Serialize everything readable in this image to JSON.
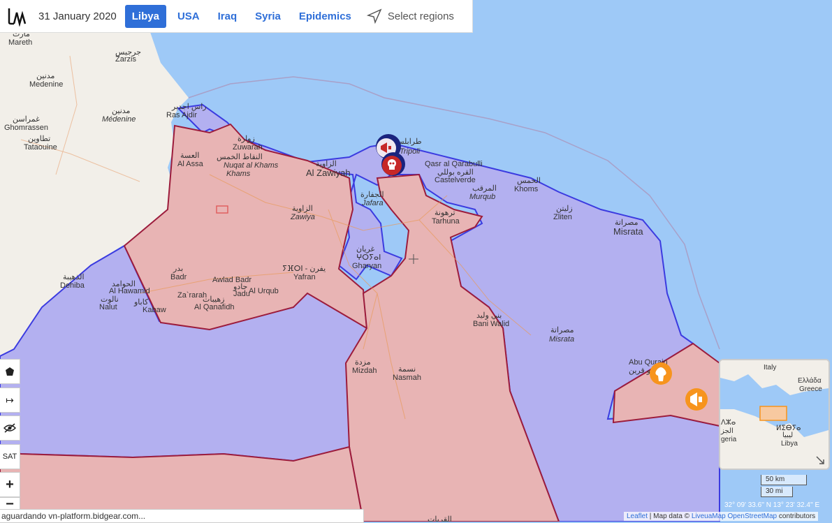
{
  "header": {
    "date": "31 January 2020",
    "tabs": [
      "Libya",
      "USA",
      "Iraq",
      "Syria",
      "Epidemics"
    ],
    "active_tab": "Libya",
    "select_regions_label": "Select regions"
  },
  "controls": {
    "polygon_icon": "polygon-icon",
    "measure_icon": "measure-icon",
    "hide_icon": "eye-slash-icon",
    "sat_label": "SAT",
    "zoom_in": "+",
    "zoom_out": "−"
  },
  "map_labels": {
    "mareth_ar": "مارث",
    "mareth": "Mareth",
    "zarzis_ar": "جرجيس",
    "zarzis": "Zarzis",
    "medenine_ar": "مدنين",
    "medenine": "Medenine",
    "medenine2_ar": "مدنين",
    "medenine2": "Médenine",
    "ghomrassen_ar": "غمراسن",
    "ghomrassen": "Ghomrassen",
    "tataouine_ar": "تطاوين",
    "tataouine": "Tataouine",
    "ras_ajdir_ar": "راس اجدير",
    "ras_ajdir": "Ras Ajdir",
    "zuwarah_ar": "زوارة",
    "zuwarah": "Zuwarah",
    "nuqat_ar": "النقاط الخمس",
    "nuqat": "Nuqat al Khams",
    "al_assa_ar": "العسة",
    "al_assa": "Al Assa",
    "al_zawiyah_ar": "الزاوية",
    "al_zawiyah": "Al Zawiyah",
    "zawiya_ar": "الزاوية",
    "zawiya": "Zawiya",
    "tripoli": "Tripoli",
    "tripoli_ar": "طرابلس",
    "jafara_ar": "الجفارة",
    "jafara": "Jafara",
    "qasr_ar": "Qasr al Qarabulli",
    "qasr_ar2": "القره بوللي",
    "castelverde": "Castelverde",
    "khoms_ar": "الخمس",
    "khoms": "Khoms",
    "murqub_ar": "المرقب",
    "murqub": "Murqub",
    "tarhuna_ar": "ترهونة",
    "tarhuna": "Tarhuna",
    "zliten_ar": "زليتن",
    "zliten": "Zliten",
    "misrata_ar": "مصراتة",
    "misrata": "Misrata",
    "gharyan_ar": "غريان",
    "gharyan_ber": "ⵖⵔⵢⴰⵏ",
    "gharyan": "Gharyan",
    "yafran_ber": "ⵢⴼⵔⵏ - يفرن",
    "yafran": "Yafran",
    "badr_ar": "بدر",
    "badr": "Badr",
    "awlad_badr": "Awlad Badr",
    "jadu_ar": "جادو",
    "jadu": "Jadu",
    "zarah": "Za`rarah",
    "al_urqub": "Al Urqub",
    "al_qanafidh_ar": "زهيبات",
    "al_qanafidh": "Al Qanafidh",
    "dehiba_ar": "الذهيبة",
    "dehiba": "Dehiba",
    "al_hawamid_ar": "الحوامد",
    "al_hawamid": "Al Hawamid",
    "nalut_ar": "نالوت",
    "nalut": "Nalut",
    "kabaw_ar": "كاباو",
    "kabaw": "Kabaw",
    "bani_walid_ar": "بني وليد",
    "bani_walid": "Bani Walid",
    "misrata_region_ar": "مصراتة",
    "misrata_region": "Misrata",
    "mizdah_ar": "مزدة",
    "mizdah": "Mizdah",
    "nasmah_ar": "نسمة",
    "nasmah": "Nasmah",
    "abu_qurain": "Abu Qurain",
    "abu_qurain_ar": "ابو قرين",
    "al_qaryat_ar": "القريات"
  },
  "minimap": {
    "italy": "Italy",
    "greece_gr": "Ελλάδα",
    "greece": "Greece",
    "libya_ber": "ⵍⵉⴱⵢⴰ",
    "libya_ar": "ليبيا",
    "libya": "Libya",
    "algeria_ber": "ⴷⵣⴰ",
    "algeria_ar": "الجز",
    "algeria": "geria"
  },
  "scale": {
    "km": "50 km",
    "mi": "30 mi"
  },
  "coordinates": "32° 09' 33.6'' N 13° 23' 32.4'' E",
  "attribution": {
    "leaflet": "Leaflet",
    "sep": " | Map data © ",
    "liveua": "LiveuaMap",
    "osm": "OpenStreetMap",
    "suffix": " contributors"
  },
  "status_bar": "aguardando vn-platform.bidgear.com...",
  "colors": {
    "sea": "#9ec9f7",
    "land": "#f2efe9",
    "gna_fill": "#b3b0f0",
    "gna_border": "#3b3be0",
    "lna_fill": "#e8b4b4",
    "lna_border": "#9c1c3c",
    "marker_orange": "#f7941d",
    "marker_red": "#c62828",
    "marker_navy": "#1a237e"
  },
  "markers": {
    "protest_icon": "megaphone-icon",
    "death_icon": "skull-icon",
    "explosion_icon": "explosion-icon"
  }
}
